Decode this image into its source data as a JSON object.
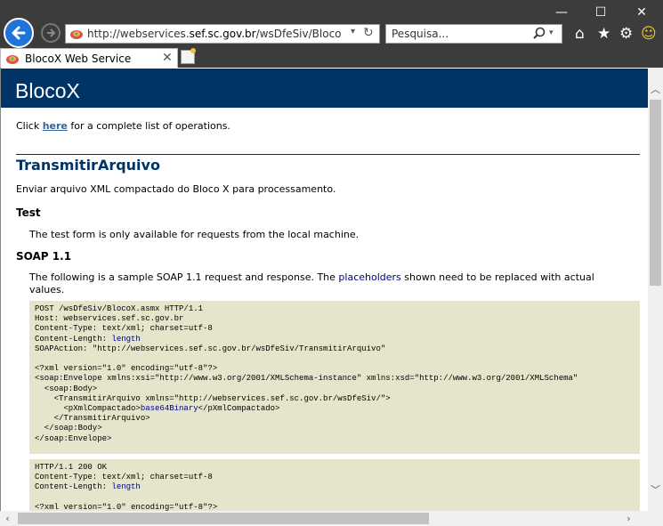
{
  "window": {
    "minimize_glyph": "—",
    "maximize_glyph": "☐",
    "close_glyph": "✕"
  },
  "toolbar": {
    "address_prefix": "http://webservices.",
    "address_host": "sef.sc.gov.br",
    "address_suffix": "/wsDfeSiv/BlocoX.asmx",
    "search_placeholder": "Pesquisa..."
  },
  "tabs": [
    {
      "label": "BlocoX Web Service"
    }
  ],
  "page": {
    "banner_title": "BlocoX",
    "intro_before": "Click ",
    "intro_link": "here",
    "intro_after": " for a complete list of operations.",
    "operation_title": "TransmitirArquivo",
    "operation_desc": "Enviar arquivo XML compactado do Bloco X para processamento.",
    "test_heading": "Test",
    "test_text": "The test form is only available for requests from the local machine.",
    "soap_heading": "SOAP 1.1",
    "soap_text_1": "The following is a sample SOAP 1.1 request and response. The ",
    "soap_placeholders": "placeholders",
    "soap_text_2": " shown need to be replaced with actual",
    "soap_text_3": "values."
  },
  "request_code": {
    "line1": "POST /wsDfeSiv/BlocoX.asmx HTTP/1.1",
    "line2": "Host: webservices.sef.sc.gov.br",
    "line3": "Content-Type: text/xml; charset=utf-8",
    "line4_label": "Content-Length: ",
    "line4_value": "length",
    "line5": "SOAPAction: \"http://webservices.sef.sc.gov.br/wsDfeSiv/TransmitirArquivo\"",
    "line6": "",
    "line7": "<?xml version=\"1.0\" encoding=\"utf-8\"?>",
    "line8": "<soap:Envelope xmlns:xsi=\"http://www.w3.org/2001/XMLSchema-instance\" xmlns:xsd=\"http://www.w3.org/2001/XMLSchema\"",
    "line9": "  <soap:Body>",
    "line10": "    <TransmitirArquivo xmlns=\"http://webservices.sef.sc.gov.br/wsDfeSiv/\">",
    "line11_open": "      <pXmlCompactado>",
    "line11_value": "base64Binary",
    "line11_close": "</pXmlCompactado>",
    "line12": "    </TransmitirArquivo>",
    "line13": "  </soap:Body>",
    "line14": "</soap:Envelope>"
  },
  "response_code": {
    "line1": "HTTP/1.1 200 OK",
    "line2": "Content-Type: text/xml; charset=utf-8",
    "line3_label": "Content-Length: ",
    "line3_value": "length",
    "line4": "",
    "line5": "<?xml version=\"1.0\" encoding=\"utf-8\"?>"
  },
  "colors": {
    "banner": "#003366",
    "code_bg": "#e5e5cc",
    "placeholder": "#000080"
  }
}
